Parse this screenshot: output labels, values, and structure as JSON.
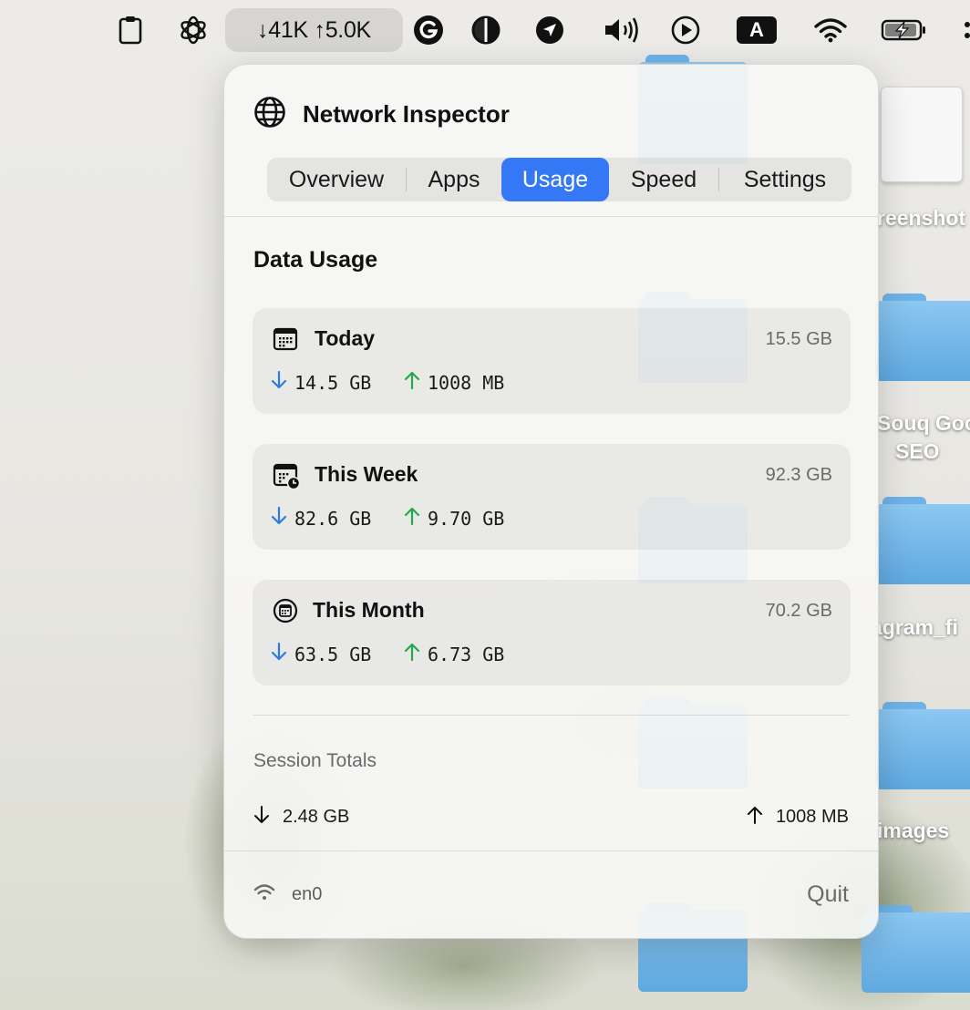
{
  "menubar": {
    "net_down": "↓41K",
    "net_up": "↑5.0K",
    "keyboard_badge": "A",
    "icons": [
      "clipboard-icon",
      "openai-icon",
      "grammarly-icon",
      "contrast-icon",
      "location-arrow-icon",
      "volume-icon",
      "play-icon",
      "keyboard-input-icon",
      "wifi-icon",
      "battery-charging-icon"
    ]
  },
  "desktop": {
    "labels": [
      "reenshot",
      "Souq Goo",
      "SEO",
      "agram_fi",
      "images"
    ]
  },
  "popover": {
    "title": "Network Inspector",
    "tabs": [
      "Overview",
      "Apps",
      "Usage",
      "Speed",
      "Settings"
    ],
    "active_tab": "Usage",
    "section_title": "Data Usage",
    "cards": [
      {
        "icon": "calendar-icon",
        "label": "Today",
        "total": "15.5 GB",
        "down": "14.5 GB",
        "up": "1008 MB"
      },
      {
        "icon": "calendar-clock-icon",
        "label": "This Week",
        "total": "92.3 GB",
        "down": "82.6 GB",
        "up": "9.70 GB"
      },
      {
        "icon": "calendar-circle-icon",
        "label": "This Month",
        "total": "70.2 GB",
        "down": "63.5 GB",
        "up": "6.73 GB"
      }
    ],
    "session": {
      "title": "Session Totals",
      "down": "2.48 GB",
      "up": "1008 MB"
    },
    "footer": {
      "interface": "en0",
      "quit_label": "Quit"
    },
    "colors": {
      "accent": "#3478f6",
      "down_arrow": "#2f7be0",
      "up_arrow": "#27a84a"
    }
  }
}
